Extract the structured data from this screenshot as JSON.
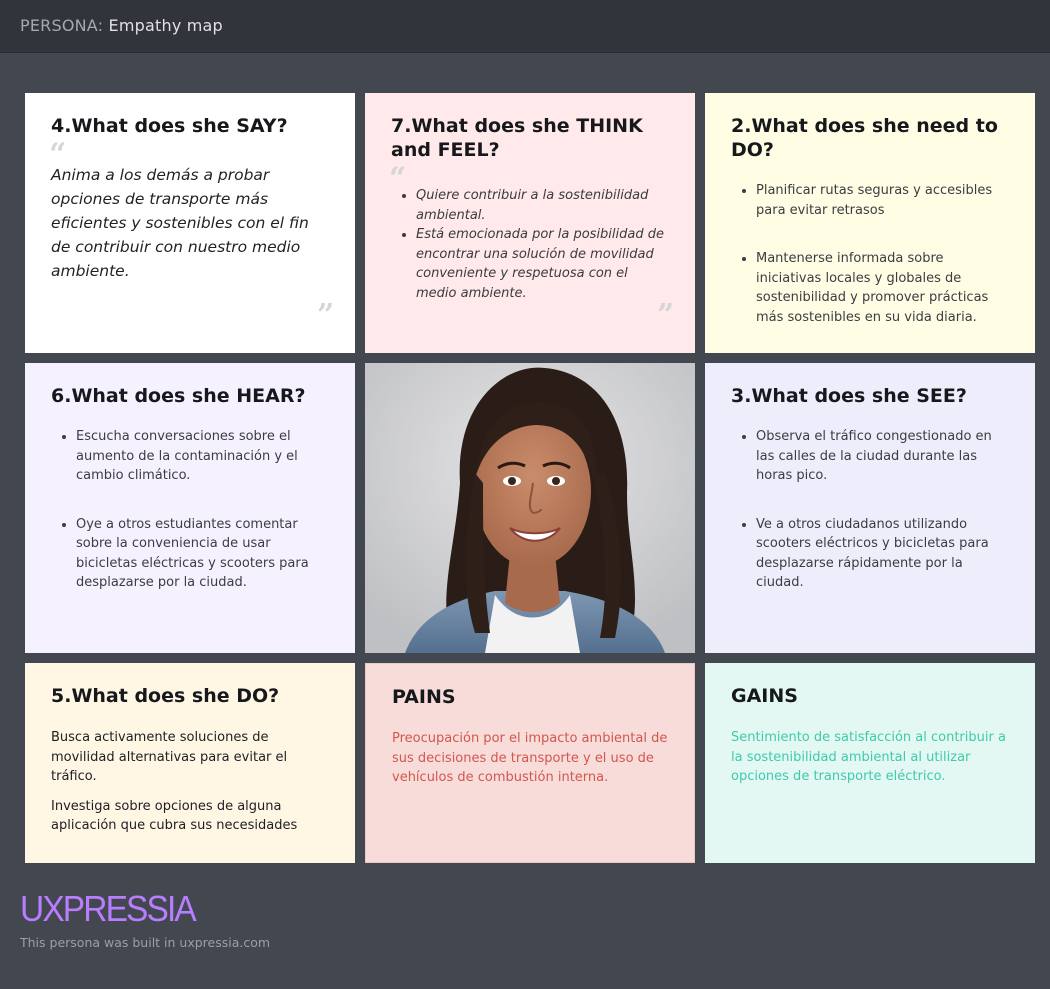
{
  "header": {
    "prefix": "PERSONA:",
    "title": "Empathy map"
  },
  "cards": {
    "say": {
      "title": "4.What does she SAY?",
      "quote": "Anima a los demás a probar opciones de transporte más eficientes y sostenibles con el fin de contribuir con nuestro medio ambiente."
    },
    "think": {
      "title": "7.What does she THINK and FEEL?",
      "items": [
        "Quiere contribuir a la sostenibilidad ambiental.",
        "Está emocionada por la posibilidad de encontrar una solución de movilidad conveniente y respetuosa con el medio ambiente."
      ]
    },
    "need": {
      "title": "2.What does she need to DO?",
      "items": [
        "Planificar rutas seguras y accesibles para evitar retrasos",
        "Mantenerse informada sobre iniciativas locales y globales de sostenibilidad y promover prácticas más sostenibles en su vida diaria."
      ]
    },
    "hear": {
      "title": "6.What does she HEAR?",
      "items": [
        "Escucha conversaciones sobre el aumento de la contaminación y el cambio climático.",
        "Oye a otros estudiantes comentar sobre la conveniencia de usar bicicletas eléctricas y scooters para desplazarse por la ciudad."
      ]
    },
    "see": {
      "title": "3.What does she SEE?",
      "items": [
        "Observa el tráfico congestionado en las calles de la ciudad durante las horas pico.",
        "Ve a otros ciudadanos utilizando scooters eléctricos y bicicletas para desplazarse rápidamente por la ciudad."
      ]
    },
    "do": {
      "title": "5.What does she DO?",
      "paragraphs": [
        "Busca activamente soluciones de movilidad alternativas para evitar el tráfico.",
        "Investiga sobre opciones de alguna aplicación que cubra sus necesidades"
      ]
    },
    "pains": {
      "title": "PAINS",
      "text": "Preocupación por el impacto ambiental de sus decisiones de transporte y el uso de vehículos de combustión interna."
    },
    "gains": {
      "title": "GAINS",
      "text": "Sentimiento de satisfacción al contribuir a la sostenibilidad ambiental al utilizar opciones de transporte eléctrico."
    }
  },
  "footer": {
    "logo": "UXPRESSIA",
    "note": "This persona was built in uxpressia.com"
  },
  "colors": {
    "background": "#434750",
    "topbar": "#31343b",
    "say": "#ffffff",
    "think": "#ffe9ea",
    "need": "#fffde4",
    "hear": "#f6f1ff",
    "see": "#eeedfb",
    "do": "#fff6e4",
    "pains": "#f8dcd9",
    "pains_text": "#d2574f",
    "gains": "#e3f7f3",
    "gains_text": "#3fcbaa",
    "logo": "#b97dff"
  }
}
